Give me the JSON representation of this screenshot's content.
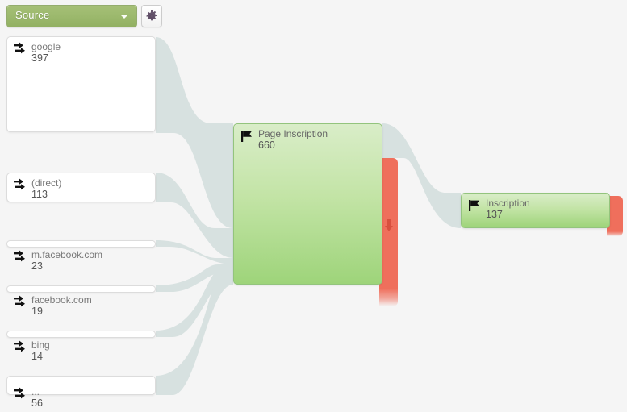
{
  "toolbar": {
    "dimension_label": "Source",
    "dimension_icon": "chevron-down-icon",
    "settings_icon": "gear-icon"
  },
  "flow": {
    "source_nodes": [
      {
        "id": "google",
        "label": "google",
        "value": "397",
        "icon": "double-arrow-icon"
      },
      {
        "id": "direct",
        "label": "(direct)",
        "value": "113",
        "icon": "double-arrow-icon"
      },
      {
        "id": "m-facebook-com",
        "label": "m.facebook.com",
        "value": "23",
        "icon": "double-arrow-icon"
      },
      {
        "id": "facebook-com",
        "label": "facebook.com",
        "value": "19",
        "icon": "double-arrow-icon"
      },
      {
        "id": "bing",
        "label": "bing",
        "value": "14",
        "icon": "double-arrow-icon"
      },
      {
        "id": "others",
        "label": "...",
        "value": "56",
        "icon": "double-arrow-icon"
      }
    ],
    "goal_nodes": [
      {
        "id": "page-inscription",
        "label": "Page Inscription",
        "value": "660",
        "icon": "flag-icon"
      },
      {
        "id": "inscription",
        "label": "Inscription",
        "value": "137",
        "icon": "flag-icon"
      }
    ],
    "dropoffs": [
      {
        "id": "dropoff-page-inscription",
        "icon": "dropoff-arrow-icon"
      },
      {
        "id": "dropoff-inscription",
        "icon": "dropoff-arrow-icon"
      }
    ]
  },
  "chart_data": {
    "type": "sankey",
    "title": "",
    "dimension": "Source",
    "nodes": [
      {
        "name": "google",
        "value": 397,
        "stage": 0,
        "kind": "source"
      },
      {
        "name": "(direct)",
        "value": 113,
        "stage": 0,
        "kind": "source"
      },
      {
        "name": "m.facebook.com",
        "value": 23,
        "stage": 0,
        "kind": "source"
      },
      {
        "name": "facebook.com",
        "value": 19,
        "stage": 0,
        "kind": "source"
      },
      {
        "name": "bing",
        "value": 14,
        "stage": 0,
        "kind": "source"
      },
      {
        "name": "...",
        "value": 56,
        "stage": 0,
        "kind": "source"
      },
      {
        "name": "Page Inscription",
        "value": 660,
        "stage": 1,
        "kind": "goal"
      },
      {
        "name": "Inscription",
        "value": 137,
        "stage": 2,
        "kind": "goal"
      }
    ],
    "links": [
      {
        "source": "google",
        "target": "Page Inscription",
        "value": 397
      },
      {
        "source": "(direct)",
        "target": "Page Inscription",
        "value": 113
      },
      {
        "source": "m.facebook.com",
        "target": "Page Inscription",
        "value": 23
      },
      {
        "source": "facebook.com",
        "target": "Page Inscription",
        "value": 19
      },
      {
        "source": "bing",
        "target": "Page Inscription",
        "value": 14
      },
      {
        "source": "...",
        "target": "Page Inscription",
        "value": 56
      },
      {
        "source": "Page Inscription",
        "target": "Inscription",
        "value": 137
      },
      {
        "source": "Page Inscription",
        "target": "drop-off",
        "value": 523
      },
      {
        "source": "Inscription",
        "target": "drop-off",
        "value": 137
      }
    ],
    "colors": {
      "ribbon": "#d7e1e0",
      "goal_node": "#9ed47a",
      "dropoff": "#ef6f5c",
      "source_node": "#ffffff",
      "background": "#f5f5f5",
      "accent": "#9cb96d"
    }
  }
}
